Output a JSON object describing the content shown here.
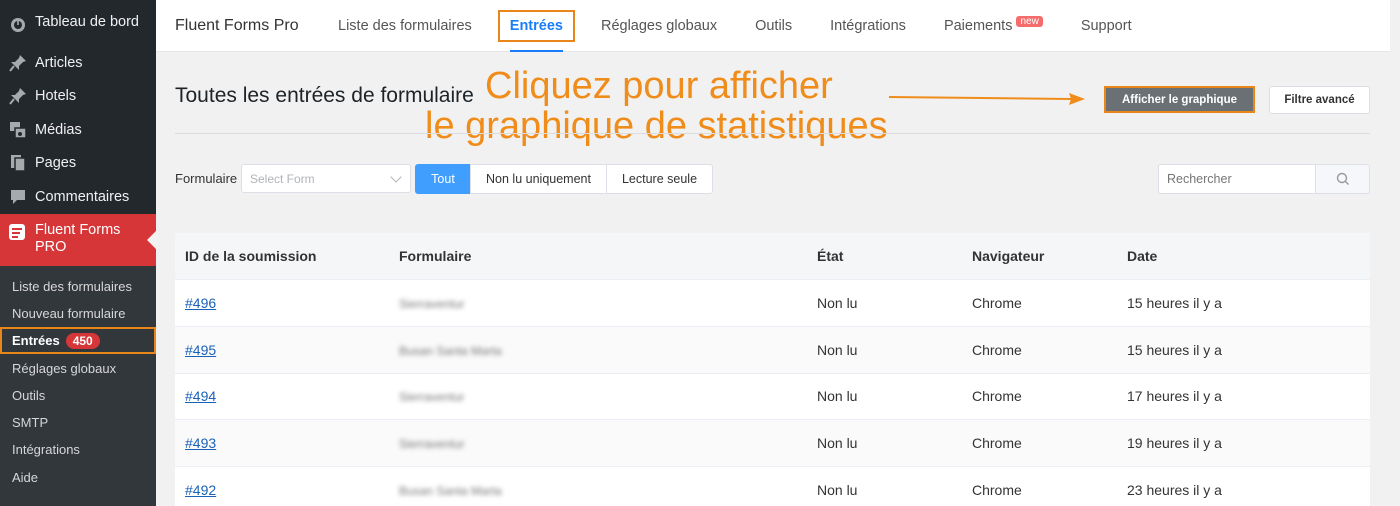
{
  "sidebar": {
    "items": [
      {
        "label": "Tableau de bord",
        "icon": "dashboard-icon"
      },
      {
        "label": "Articles",
        "icon": "pin-icon"
      },
      {
        "label": "Hotels",
        "icon": "pin-icon"
      },
      {
        "label": "Médias",
        "icon": "media-icon"
      },
      {
        "label": "Pages",
        "icon": "pages-icon"
      },
      {
        "label": "Commentaires",
        "icon": "comment-icon"
      }
    ],
    "active": {
      "label_line1": "Fluent Forms",
      "label_line2": "PRO",
      "icon": "fluent-forms-icon"
    },
    "submenu": [
      "Liste des formulaires",
      "Nouveau formulaire",
      "Entrées",
      "Réglages globaux",
      "Outils",
      "SMTP",
      "Intégrations",
      "Aide"
    ],
    "entries_count": "450"
  },
  "topnav": {
    "brand": "Fluent Forms Pro",
    "tabs": [
      "Liste des formulaires",
      "Entrées",
      "Réglages globaux",
      "Outils",
      "Intégrations",
      "Paiements",
      "Support"
    ],
    "new_tag": "new"
  },
  "main": {
    "title": "Toutes les entrées de formulaire",
    "annotation_line1": "Cliquez pour afficher",
    "annotation_line2": "le graphique de statistiques",
    "show_chart_button": "Afficher le graphique",
    "advanced_filter_button": "Filtre avancé"
  },
  "filters": {
    "form_label": "Formulaire",
    "form_placeholder": "Select Form",
    "all": "Tout",
    "unread_only": "Non lu uniquement",
    "read_only": "Lecture seule",
    "search_placeholder": "Rechercher"
  },
  "table": {
    "headers": [
      "ID de la soumission",
      "Formulaire",
      "État",
      "Navigateur",
      "Date"
    ],
    "rows": [
      {
        "id": "#496",
        "form": "Sierraventur",
        "status": "Non lu",
        "browser": "Chrome",
        "date": "15 heures il y a"
      },
      {
        "id": "#495",
        "form": "Busan Santa Marta",
        "status": "Non lu",
        "browser": "Chrome",
        "date": "15 heures il y a"
      },
      {
        "id": "#494",
        "form": "Sierraventur",
        "status": "Non lu",
        "browser": "Chrome",
        "date": "17 heures il y a"
      },
      {
        "id": "#493",
        "form": "Sierraventur",
        "status": "Non lu",
        "browser": "Chrome",
        "date": "19 heures il y a"
      },
      {
        "id": "#492",
        "form": "Busan Santa Marta",
        "status": "Non lu",
        "browser": "Chrome",
        "date": "23 heures il y a"
      }
    ]
  },
  "colors": {
    "accent": "#1a7efb",
    "annotation": "#f08c1a",
    "active_menu": "#d63638"
  }
}
